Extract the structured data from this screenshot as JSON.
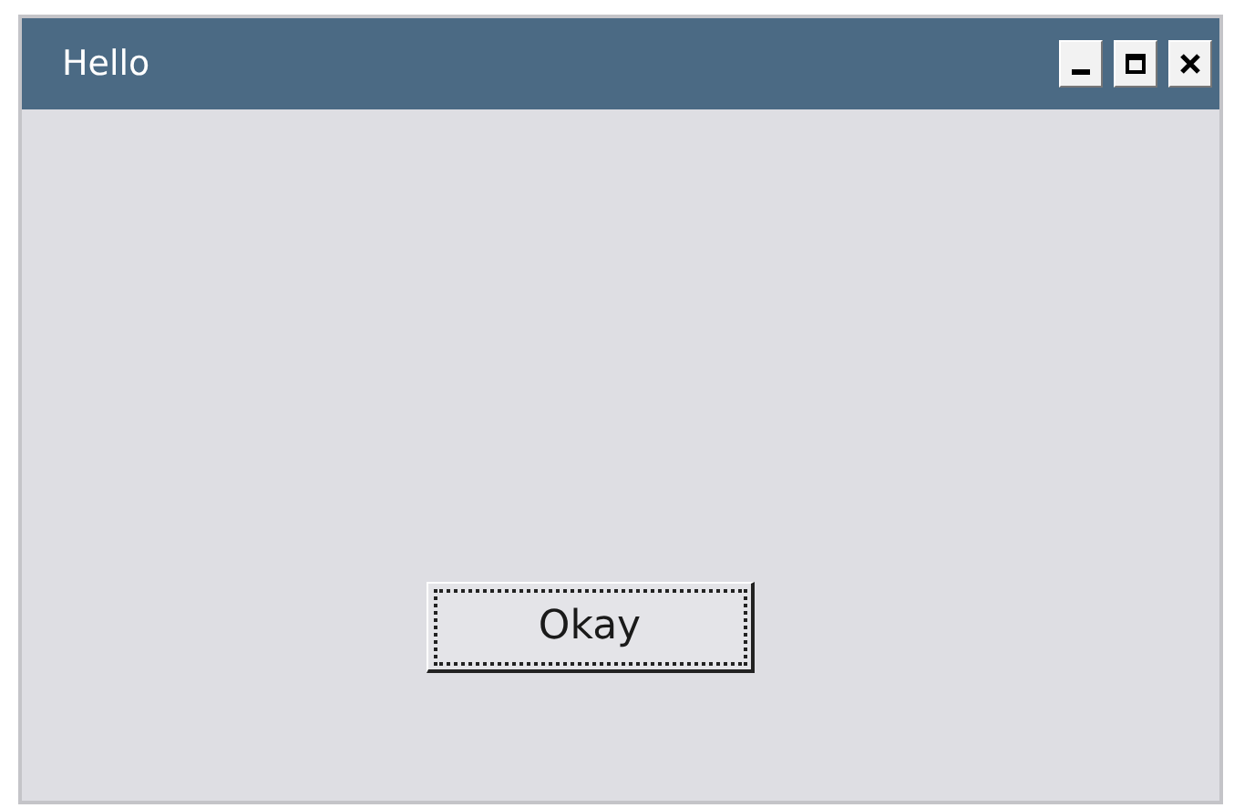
{
  "window": {
    "title": "Hello",
    "controls": [
      {
        "kind": "minimize"
      },
      {
        "kind": "maximize"
      },
      {
        "kind": "close"
      }
    ]
  },
  "button": {
    "label": "Okay",
    "focused": true
  }
}
